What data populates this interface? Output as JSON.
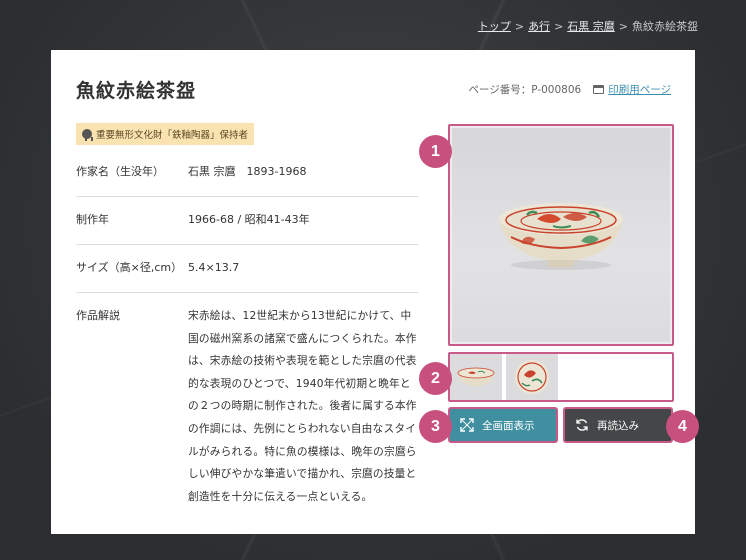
{
  "breadcrumb": {
    "items": [
      "トップ",
      "あ行",
      "石黒 宗麿"
    ],
    "current": "魚紋赤絵茶盌",
    "sep": ">"
  },
  "page": {
    "title": "魚紋赤絵茶盌",
    "page_number": "ページ番号：P-000806",
    "print_label": "印刷用ページ",
    "badge": "重要無形文化財「鉄釉陶器」保持者"
  },
  "info": {
    "artist_label": "作家名（生没年）",
    "artist_value": "石黒 宗麿　1893-1968",
    "year_label": "制作年",
    "year_value": "1966-68 / 昭和41-43年",
    "size_label": "サイズ（高×径,cm）",
    "size_value": "5.4×13.7",
    "desc_label": "作品解説",
    "desc_value": "宋赤絵は、12世紀末から13世紀にかけて、中国の磁州窯系の諸窯で盛んにつくられた。本作は、宋赤絵の技術や表現を範とした宗麿の代表的な表現のひとつで、1940年代初期と晩年との２つの時期に制作された。後者に属する本作の作調には、先例にとらわれない自由なスタイルがみられる。特に魚の模様は、晩年の宗麿らしい伸びやかな筆遣いで描かれ、宗麿の技量と創造性を十分に伝える一点といえる。"
  },
  "buttons": {
    "fullscreen": "全画面表示",
    "reload": "再読込み"
  },
  "markers": [
    "1",
    "2",
    "3",
    "4"
  ],
  "colors": {
    "accent": "#c8507f",
    "fullscreen_bg": "#3f8fa0",
    "reload_bg": "#444648",
    "badge_bg": "#fbe3b1",
    "link": "#3c8fb0"
  },
  "icons": {
    "print": "printer-icon",
    "badge": "medal-icon",
    "fullscreen": "expand-icon",
    "reload": "refresh-icon"
  }
}
